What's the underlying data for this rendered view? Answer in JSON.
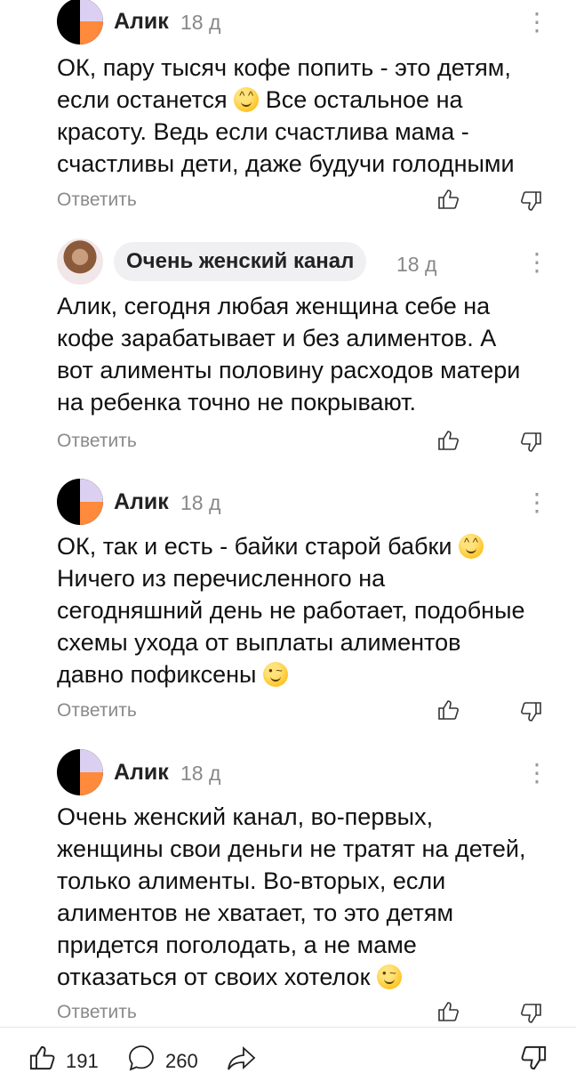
{
  "comments": [
    {
      "author": "Алик",
      "time": "18 д",
      "text": "ОК, пару тысяч кофе попить - это детям,\nесли останется",
      "emoji": "grinning-sweat",
      "text_after": " Все остальное на\nкрасоту. Ведь если счастлива мама -\nсчастливы дети, даже будучи голодными",
      "reply_label": "Ответить"
    },
    {
      "author": "Очень женский канал",
      "time": "18 д",
      "text": "Алик, сегодня любая женщина себе на\nкофе зарабатывает и без алиментов. А\nвот алименты половину расходов матери\nна ребенка точно не покрывают.",
      "reply_label": "Ответить"
    },
    {
      "author": "Алик",
      "time": "18 д",
      "text": "ОК, так и есть - байки старой бабки",
      "emoji": "grinning-sweat",
      "text_after": "\nНичего из перечисленного на\nсегодняшний день не работает, подобные\nсхемы ухода от выплаты алиментов\nдавно пофиксены",
      "emoji2": "winking-face",
      "reply_label": "Ответить"
    },
    {
      "author": "Алик",
      "time": "18 д",
      "text": "Очень женский канал, во-первых,\nженщины свои деньги не тратят на детей,\nтолько алименты. Во-вторых, если\nалиментов не хватает, то это детям\nпридется поголодать, а не маме\nотказаться от своих хотелок",
      "emoji2": "winking-face",
      "reply_label": "Ответить"
    }
  ],
  "bottom_bar": {
    "likes": "191",
    "comments": "260"
  },
  "icons": [
    "more-icon",
    "like-icon",
    "dislike-icon",
    "comment-icon",
    "share-icon"
  ]
}
